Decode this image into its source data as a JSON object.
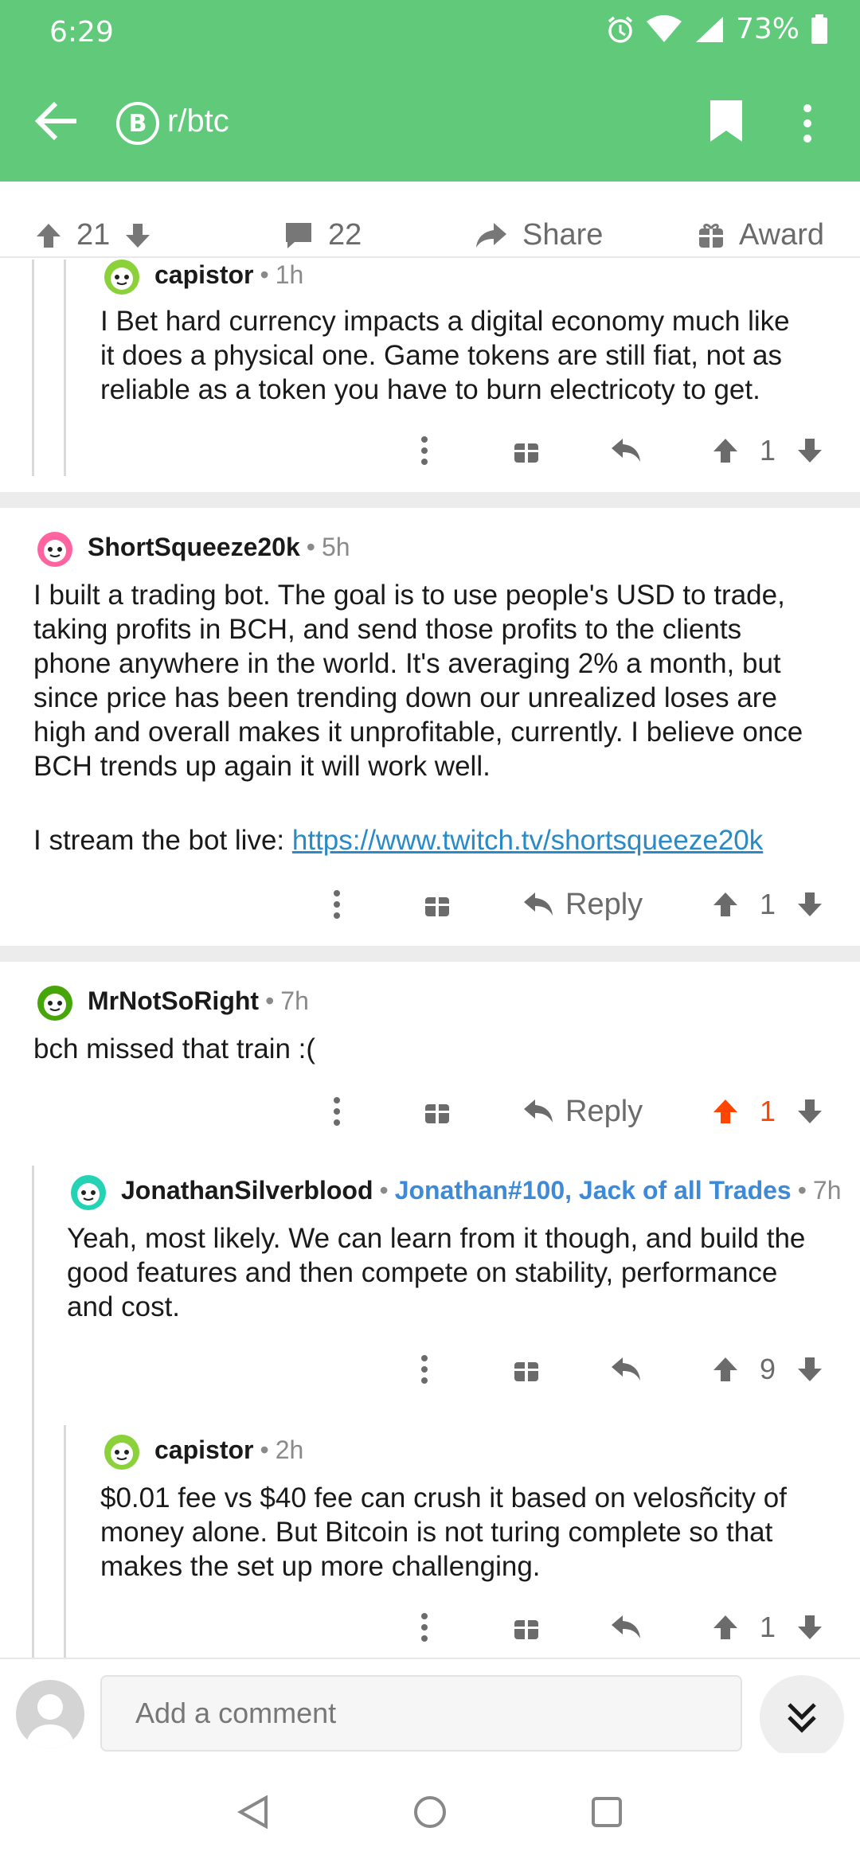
{
  "status_bar": {
    "time": "6:29",
    "battery": "73%"
  },
  "app_bar": {
    "subreddit": "r/btc",
    "subreddit_icon": "bitcoin-icon"
  },
  "post_actions": {
    "upvotes": "21",
    "comments": "22",
    "share_label": "Share",
    "award_label": "Award"
  },
  "comments": [
    {
      "author": "capistor",
      "time": "1h",
      "body": [
        "I Bet hard currency impacts a digital economy much like",
        "it does a physical one. Game tokens are still fiat, not as",
        "reliable as a token you have to burn electricoty to get."
      ],
      "score": "1"
    },
    {
      "author": "ShortSqueeze20k",
      "time": "5h",
      "body": [
        "I built a trading bot. The goal is to use people's USD to trade,",
        "taking profits in BCH, and send those profits to the clients",
        "phone anywhere in the world. It's averaging 2% a month, but",
        "since price has been trending down our unrealized loses are",
        "high and overall makes it unprofitable, currently. I believe once",
        "BCH trends up again it will work well."
      ],
      "stream_text": "I stream the bot live: ",
      "link": "https://www.twitch.tv/shortsqueeze20k",
      "reply_label": "Reply",
      "score": "1"
    },
    {
      "author": "MrNotSoRight",
      "time": "7h",
      "body": [
        "bch missed that train :("
      ],
      "reply_label": "Reply",
      "score": "1",
      "upvoted": true,
      "upvote_color": "#ff4500"
    },
    {
      "author": "JonathanSilverblood",
      "flair": "Jonathan#100, Jack of all Trades",
      "time": "7h",
      "body": [
        "Yeah, most likely. We can learn from it though, and build the",
        "good features and then compete on stability, performance",
        "and cost."
      ],
      "score": "9"
    },
    {
      "author": "capistor",
      "time": "2h",
      "body": [
        "$0.01 fee vs $40 fee can crush it based on velosñcity of",
        "money alone. But Bitcoin is not turing complete so that",
        "makes the set up more challenging."
      ],
      "score": "1"
    }
  ],
  "composer": {
    "placeholder": "Add a comment"
  },
  "colors": {
    "brand_green": "#60c97a",
    "upvote_orange": "#ff4500",
    "link_blue": "#2a8ac7"
  }
}
